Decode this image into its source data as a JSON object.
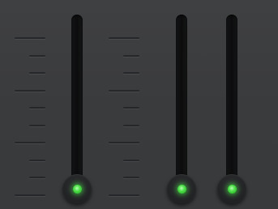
{
  "mixer": {
    "faders": [
      {
        "id": "fader-1",
        "level": 0.0,
        "indicator": "green-led",
        "led_color": "#4fe04a"
      },
      {
        "id": "fader-2",
        "level": 0.0,
        "indicator": "green-led",
        "led_color": "#4fe04a"
      },
      {
        "id": "fader-3",
        "level": 0.0,
        "indicator": "green-led",
        "led_color": "#4fe04a"
      }
    ],
    "scales": [
      {
        "id": "scale-left",
        "ticks": [
          "major",
          "minor",
          "minor",
          "major",
          "minor",
          "minor",
          "major",
          "minor",
          "minor",
          "major"
        ]
      },
      {
        "id": "scale-right",
        "ticks": [
          "major",
          "minor",
          "minor",
          "major",
          "minor",
          "minor",
          "major",
          "minor",
          "minor",
          "major"
        ]
      }
    ],
    "colors": {
      "background": "#3b3c3e",
      "track": "#0c0c0d",
      "tick": "#26272a",
      "led": "#4fe04a"
    }
  }
}
